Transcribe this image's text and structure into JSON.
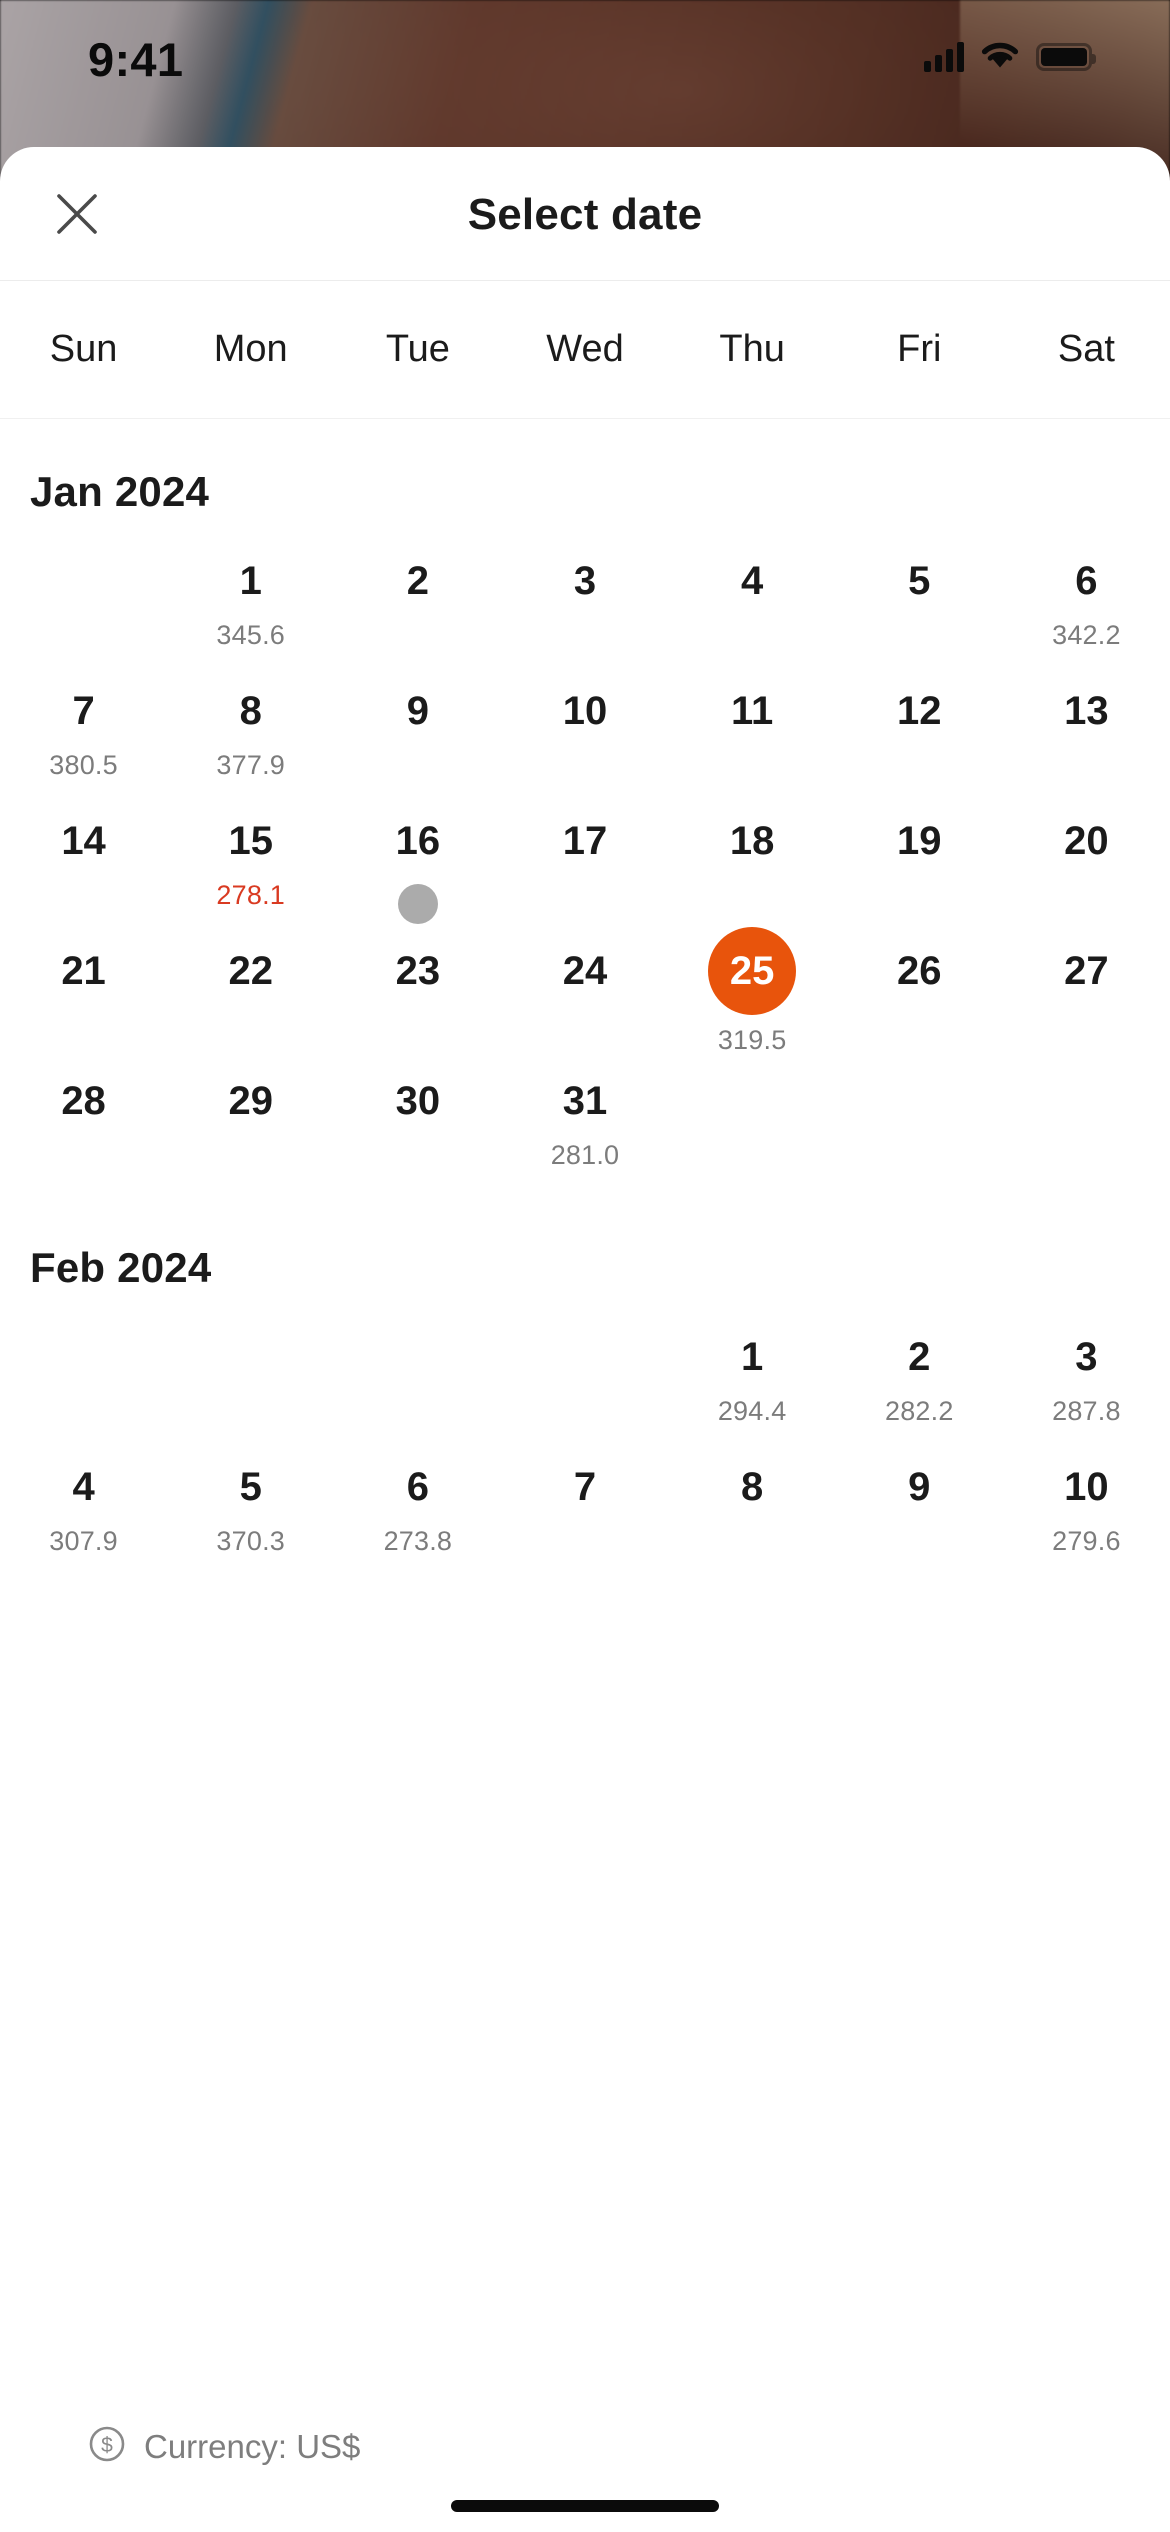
{
  "status_bar": {
    "time": "9:41",
    "cellular_icon": "signal-bars-icon",
    "wifi_icon": "wifi-icon",
    "battery_icon": "battery-icon"
  },
  "header": {
    "title": "Select date",
    "close_icon": "close-icon"
  },
  "weekdays": [
    "Sun",
    "Mon",
    "Tue",
    "Wed",
    "Thu",
    "Fri",
    "Sat"
  ],
  "colors": {
    "selected_bg": "#E8540C",
    "selected_text": "#FFFFFF",
    "low_price": "#D93A21",
    "price_text": "#7C7C7C",
    "day_text": "#1B1B1B",
    "loading_dot": "#ABABAB"
  },
  "months": [
    {
      "title": "Jan 2024",
      "weeks": [
        [
          {
            "empty": true
          },
          {
            "day": "1",
            "price": "345.6"
          },
          {
            "day": "2"
          },
          {
            "day": "3"
          },
          {
            "day": "4"
          },
          {
            "day": "5"
          },
          {
            "day": "6",
            "price": "342.2"
          }
        ],
        [
          {
            "day": "7",
            "price": "380.5"
          },
          {
            "day": "8",
            "price": "377.9"
          },
          {
            "day": "9"
          },
          {
            "day": "10"
          },
          {
            "day": "11"
          },
          {
            "day": "12"
          },
          {
            "day": "13"
          }
        ],
        [
          {
            "day": "14"
          },
          {
            "day": "15",
            "price": "278.1",
            "price_state": "low"
          },
          {
            "day": "16",
            "loading": true
          },
          {
            "day": "17"
          },
          {
            "day": "18"
          },
          {
            "day": "19"
          },
          {
            "day": "20"
          }
        ],
        [
          {
            "day": "21"
          },
          {
            "day": "22"
          },
          {
            "day": "23"
          },
          {
            "day": "24"
          },
          {
            "day": "25",
            "price": "319.5",
            "selected": true
          },
          {
            "day": "26"
          },
          {
            "day": "27"
          }
        ],
        [
          {
            "day": "28"
          },
          {
            "day": "29"
          },
          {
            "day": "30"
          },
          {
            "day": "31",
            "price": "281.0"
          },
          {
            "empty": true
          },
          {
            "empty": true
          },
          {
            "empty": true
          }
        ]
      ]
    },
    {
      "title": "Feb 2024",
      "weeks": [
        [
          {
            "empty": true
          },
          {
            "empty": true
          },
          {
            "empty": true
          },
          {
            "empty": true
          },
          {
            "day": "1",
            "price": "294.4"
          },
          {
            "day": "2",
            "price": "282.2"
          },
          {
            "day": "3",
            "price": "287.8"
          }
        ],
        [
          {
            "day": "4",
            "price": "307.9"
          },
          {
            "day": "5",
            "price": "370.3"
          },
          {
            "day": "6",
            "price": "273.8"
          },
          {
            "day": "7"
          },
          {
            "day": "8"
          },
          {
            "day": "9"
          },
          {
            "day": "10",
            "price": "279.6"
          }
        ]
      ]
    }
  ],
  "footer": {
    "currency_icon": "currency-dollar-circle-icon",
    "currency_label": "Currency: US$"
  }
}
